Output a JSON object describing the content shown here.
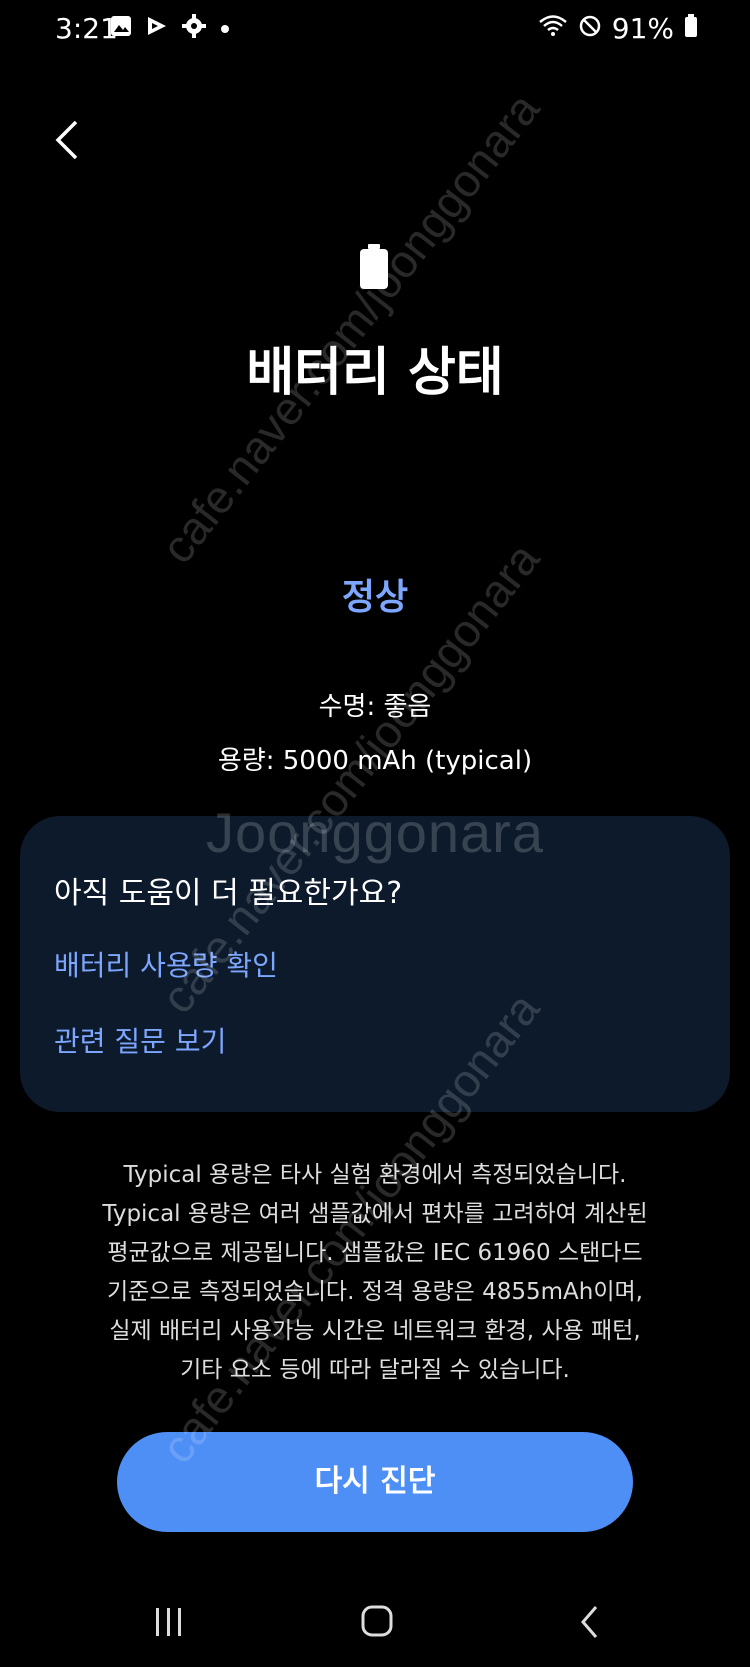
{
  "status_bar": {
    "time": "3:21",
    "battery_percent": "91%",
    "left_icons": [
      "gallery-icon",
      "media-icon",
      "settings-gear-icon",
      "dot-icon"
    ],
    "right_icons": [
      "wifi-icon",
      "do-not-disturb-icon",
      "battery-icon"
    ]
  },
  "header": {
    "back_icon": "chevron-left-icon",
    "battery_icon": "battery-icon",
    "title": "배터리 상태"
  },
  "status": {
    "state": "정상",
    "life": "수명: 좋음",
    "capacity": "용량: 5000 mAh (typical)",
    "state_color": "#7da6ff"
  },
  "help_card": {
    "title": "아직 도움이 더 필요한가요?",
    "link_usage": "배터리 사용량 확인",
    "link_faq": "관련 질문 보기"
  },
  "description": {
    "lines": [
      "Typical 용량은 타사 실험 환경에서 측정되었습니다.",
      "Typical 용량은 여러 샘플값에서 편차를 고려하여 계산된",
      "평균값으로 제공됩니다. 샘플값은 IEC 61960 스탠다드",
      "기준으로 측정되었습니다. 정격 용량은 4855mAh이며,",
      "실제 배터리 사용가능 시간은 네트워크 환경, 사용 패턴,",
      "기타 요소 등에 따라 달라질 수 있습니다."
    ]
  },
  "action": {
    "rediagnose_label": "다시 진단",
    "button_color": "#4e8ff6"
  },
  "nav_bar": {
    "recent_icon": "recent-apps-icon",
    "home_icon": "home-icon",
    "back_icon": "back-icon"
  },
  "watermark": {
    "logo": "Joonggonara",
    "diagonal": "cafe.naver.com/joonggonara"
  }
}
